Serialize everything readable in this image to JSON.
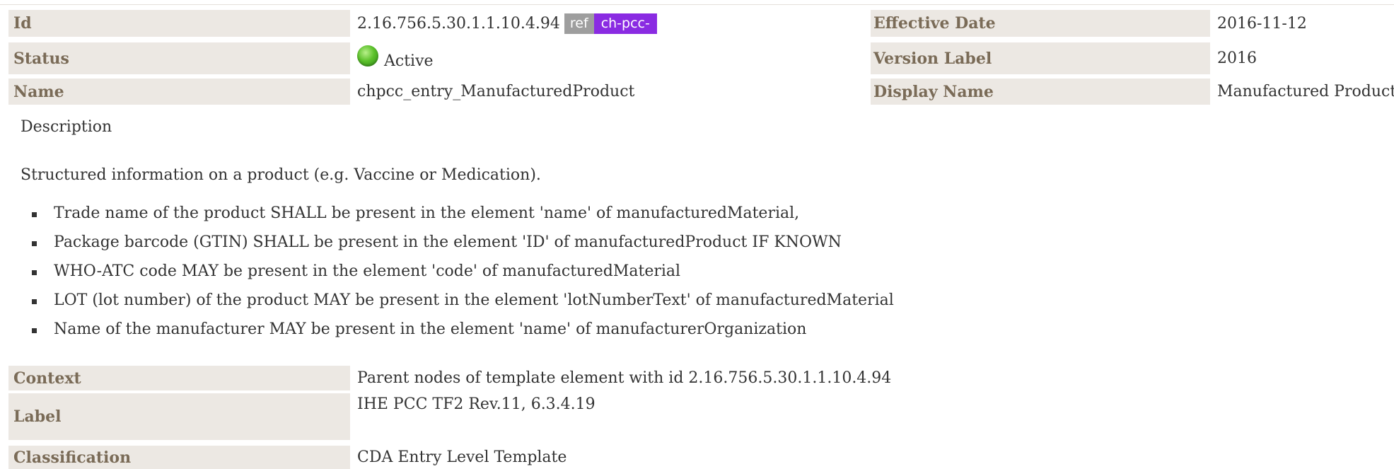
{
  "rows": {
    "id": {
      "label": "Id",
      "value": "2.16.756.5.30.1.1.10.4.94",
      "badge_ref": "ref",
      "badge_class": "ch-pcc-"
    },
    "effective_date": {
      "label": "Effective Date",
      "value": "2016-11-12"
    },
    "status": {
      "label": "Status",
      "value": "Active",
      "indicator_color": "#5cc12b"
    },
    "version_label": {
      "label": "Version Label",
      "value": "2016"
    },
    "name": {
      "label": "Name",
      "value": "chpcc_entry_ManufacturedProduct"
    },
    "display_name": {
      "label": "Display Name",
      "value": "Manufactured Product"
    }
  },
  "description": {
    "heading": "Description",
    "summary": "Structured information on a product (e.g. Vaccine or Medication).",
    "items": [
      "Trade name of the product SHALL be present in the element 'name' of manufacturedMaterial,",
      "Package barcode (GTIN) SHALL be present in the element 'ID' of manufacturedProduct IF KNOWN",
      "WHO-ATC code MAY be present in the element 'code' of manufacturedMaterial",
      "LOT (lot number) of the product MAY be present in the element 'lotNumberText' of manufacturedMaterial",
      "Name of the manufacturer MAY be present in the element 'name' of manufacturerOrganization"
    ]
  },
  "context": {
    "label": "Context",
    "value": "Parent nodes of template element with id 2.16.756.5.30.1.1.10.4.94"
  },
  "label_row": {
    "label": "Label",
    "value": "IHE PCC TF2 Rev.11, 6.3.4.19"
  },
  "classification": {
    "label": "Classification",
    "value": "CDA Entry Level Template"
  },
  "colors": {
    "label_bg": "#ece8e3",
    "label_text": "#7a6b57",
    "badge_ref_bg": "#9e9e9e",
    "badge_class_bg": "#8a2be2"
  }
}
